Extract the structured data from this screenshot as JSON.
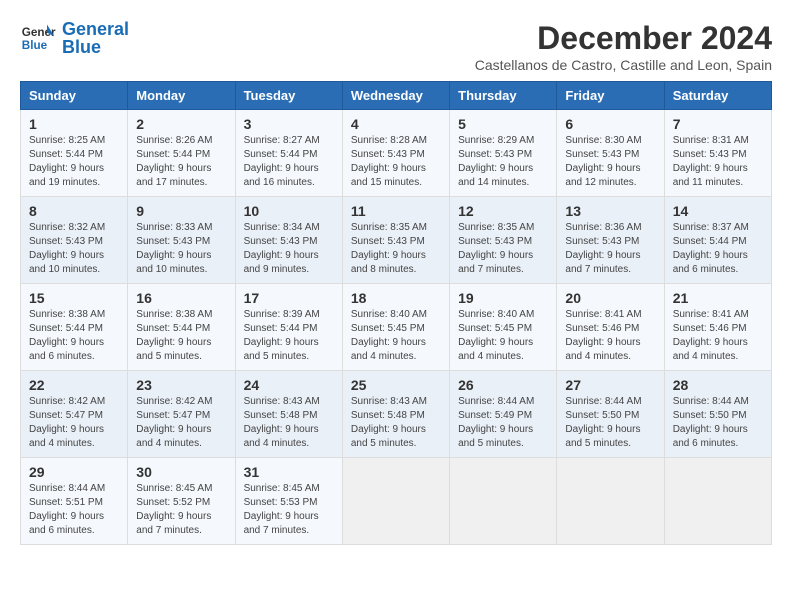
{
  "logo": {
    "line1": "General",
    "line2": "Blue"
  },
  "title": "December 2024",
  "location": "Castellanos de Castro, Castille and Leon, Spain",
  "weekdays": [
    "Sunday",
    "Monday",
    "Tuesday",
    "Wednesday",
    "Thursday",
    "Friday",
    "Saturday"
  ],
  "weeks": [
    [
      {
        "day": 1,
        "sunrise": "8:25 AM",
        "sunset": "5:44 PM",
        "daylight": "9 hours and 19 minutes."
      },
      {
        "day": 2,
        "sunrise": "8:26 AM",
        "sunset": "5:44 PM",
        "daylight": "9 hours and 17 minutes."
      },
      {
        "day": 3,
        "sunrise": "8:27 AM",
        "sunset": "5:44 PM",
        "daylight": "9 hours and 16 minutes."
      },
      {
        "day": 4,
        "sunrise": "8:28 AM",
        "sunset": "5:43 PM",
        "daylight": "9 hours and 15 minutes."
      },
      {
        "day": 5,
        "sunrise": "8:29 AM",
        "sunset": "5:43 PM",
        "daylight": "9 hours and 14 minutes."
      },
      {
        "day": 6,
        "sunrise": "8:30 AM",
        "sunset": "5:43 PM",
        "daylight": "9 hours and 12 minutes."
      },
      {
        "day": 7,
        "sunrise": "8:31 AM",
        "sunset": "5:43 PM",
        "daylight": "9 hours and 11 minutes."
      }
    ],
    [
      {
        "day": 8,
        "sunrise": "8:32 AM",
        "sunset": "5:43 PM",
        "daylight": "9 hours and 10 minutes."
      },
      {
        "day": 9,
        "sunrise": "8:33 AM",
        "sunset": "5:43 PM",
        "daylight": "9 hours and 10 minutes."
      },
      {
        "day": 10,
        "sunrise": "8:34 AM",
        "sunset": "5:43 PM",
        "daylight": "9 hours and 9 minutes."
      },
      {
        "day": 11,
        "sunrise": "8:35 AM",
        "sunset": "5:43 PM",
        "daylight": "9 hours and 8 minutes."
      },
      {
        "day": 12,
        "sunrise": "8:35 AM",
        "sunset": "5:43 PM",
        "daylight": "9 hours and 7 minutes."
      },
      {
        "day": 13,
        "sunrise": "8:36 AM",
        "sunset": "5:43 PM",
        "daylight": "9 hours and 7 minutes."
      },
      {
        "day": 14,
        "sunrise": "8:37 AM",
        "sunset": "5:44 PM",
        "daylight": "9 hours and 6 minutes."
      }
    ],
    [
      {
        "day": 15,
        "sunrise": "8:38 AM",
        "sunset": "5:44 PM",
        "daylight": "9 hours and 6 minutes."
      },
      {
        "day": 16,
        "sunrise": "8:38 AM",
        "sunset": "5:44 PM",
        "daylight": "9 hours and 5 minutes."
      },
      {
        "day": 17,
        "sunrise": "8:39 AM",
        "sunset": "5:44 PM",
        "daylight": "9 hours and 5 minutes."
      },
      {
        "day": 18,
        "sunrise": "8:40 AM",
        "sunset": "5:45 PM",
        "daylight": "9 hours and 4 minutes."
      },
      {
        "day": 19,
        "sunrise": "8:40 AM",
        "sunset": "5:45 PM",
        "daylight": "9 hours and 4 minutes."
      },
      {
        "day": 20,
        "sunrise": "8:41 AM",
        "sunset": "5:46 PM",
        "daylight": "9 hours and 4 minutes."
      },
      {
        "day": 21,
        "sunrise": "8:41 AM",
        "sunset": "5:46 PM",
        "daylight": "9 hours and 4 minutes."
      }
    ],
    [
      {
        "day": 22,
        "sunrise": "8:42 AM",
        "sunset": "5:47 PM",
        "daylight": "9 hours and 4 minutes."
      },
      {
        "day": 23,
        "sunrise": "8:42 AM",
        "sunset": "5:47 PM",
        "daylight": "9 hours and 4 minutes."
      },
      {
        "day": 24,
        "sunrise": "8:43 AM",
        "sunset": "5:48 PM",
        "daylight": "9 hours and 4 minutes."
      },
      {
        "day": 25,
        "sunrise": "8:43 AM",
        "sunset": "5:48 PM",
        "daylight": "9 hours and 5 minutes."
      },
      {
        "day": 26,
        "sunrise": "8:44 AM",
        "sunset": "5:49 PM",
        "daylight": "9 hours and 5 minutes."
      },
      {
        "day": 27,
        "sunrise": "8:44 AM",
        "sunset": "5:50 PM",
        "daylight": "9 hours and 5 minutes."
      },
      {
        "day": 28,
        "sunrise": "8:44 AM",
        "sunset": "5:50 PM",
        "daylight": "9 hours and 6 minutes."
      }
    ],
    [
      {
        "day": 29,
        "sunrise": "8:44 AM",
        "sunset": "5:51 PM",
        "daylight": "9 hours and 6 minutes."
      },
      {
        "day": 30,
        "sunrise": "8:45 AM",
        "sunset": "5:52 PM",
        "daylight": "9 hours and 7 minutes."
      },
      {
        "day": 31,
        "sunrise": "8:45 AM",
        "sunset": "5:53 PM",
        "daylight": "9 hours and 7 minutes."
      },
      null,
      null,
      null,
      null
    ]
  ],
  "labels": {
    "sunrise": "Sunrise:",
    "sunset": "Sunset:",
    "daylight": "Daylight:"
  }
}
